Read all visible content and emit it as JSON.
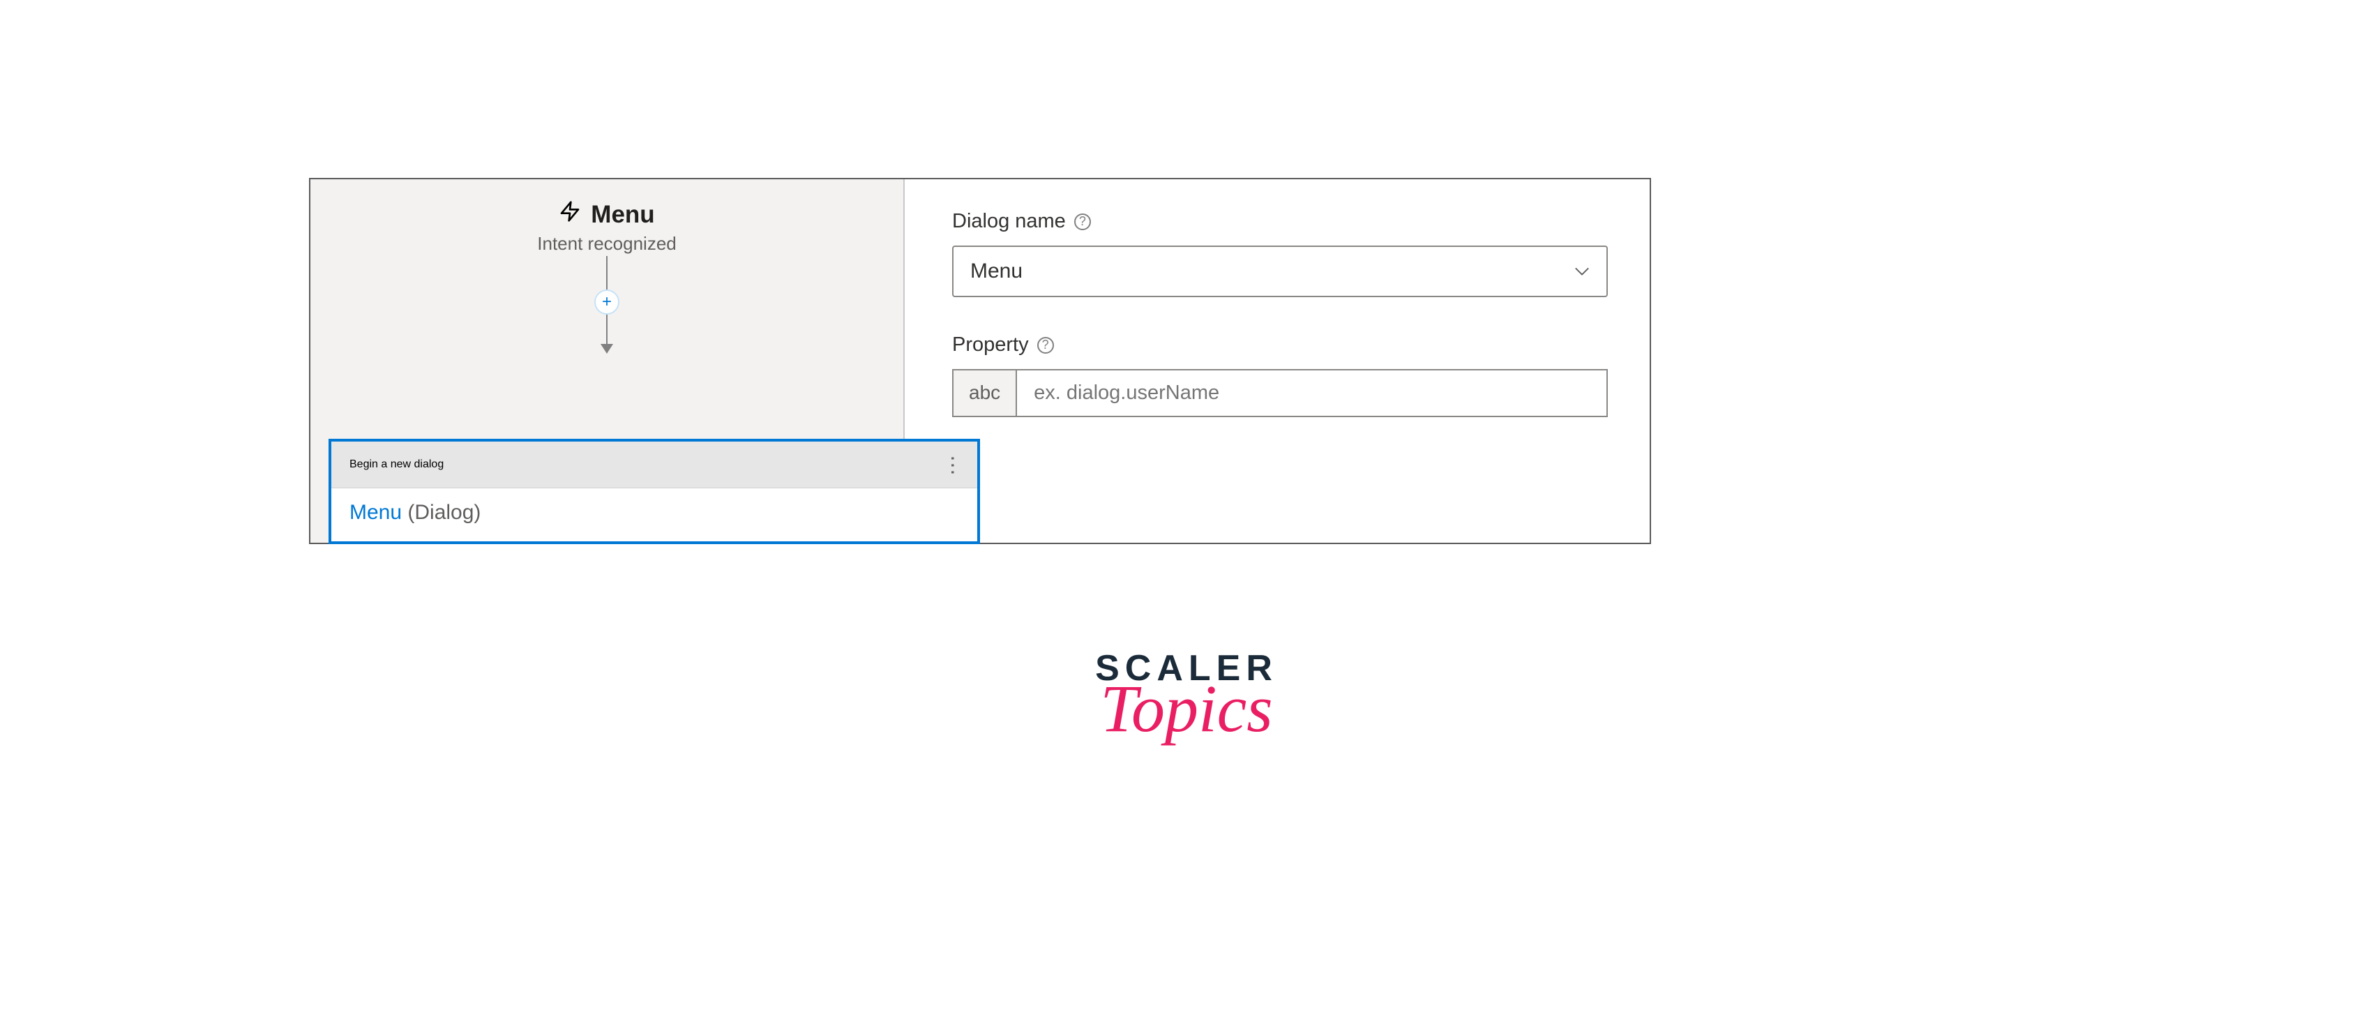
{
  "trigger": {
    "title": "Menu",
    "subtitle": "Intent recognized"
  },
  "node": {
    "header_title": "Begin a new dialog",
    "body_link": "Menu",
    "body_type": " (Dialog)"
  },
  "props": {
    "dialog_name": {
      "label": "Dialog name",
      "value": "Menu"
    },
    "property": {
      "label": "Property",
      "prefix": "abc",
      "placeholder": "ex. dialog.userName"
    }
  },
  "logo": {
    "line1": "SCALER",
    "line2": "Topics"
  }
}
